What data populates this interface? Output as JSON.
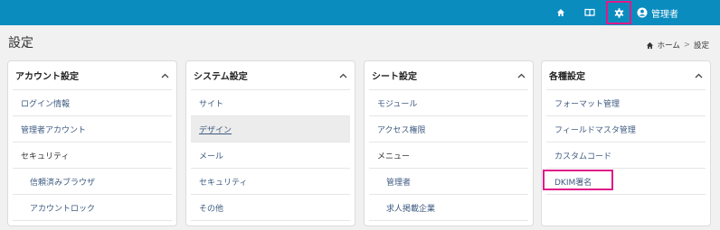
{
  "header": {
    "user_name": "管理者"
  },
  "page": {
    "title": "設定",
    "breadcrumb": {
      "home": "ホーム",
      "sep": ">",
      "current": "設定"
    }
  },
  "cards": [
    {
      "title": "アカウント設定",
      "items": [
        {
          "label": "ログイン情報"
        },
        {
          "label": "管理者アカウント"
        },
        {
          "label": "セキュリティ"
        },
        {
          "label": "信頼済みブラウザ"
        },
        {
          "label": "アカウントロック"
        }
      ]
    },
    {
      "title": "システム設定",
      "items": [
        {
          "label": "サイト"
        },
        {
          "label": "デザイン"
        },
        {
          "label": "メール"
        },
        {
          "label": "セキュリティ"
        },
        {
          "label": "その他"
        }
      ]
    },
    {
      "title": "シート設定",
      "items": [
        {
          "label": "モジュール"
        },
        {
          "label": "アクセス権限"
        },
        {
          "label": "メニュー"
        },
        {
          "label": "管理者"
        },
        {
          "label": "求人掲載企業"
        }
      ]
    },
    {
      "title": "各種設定",
      "items": [
        {
          "label": "フォーマット管理"
        },
        {
          "label": "フィールドマスタ管理"
        },
        {
          "label": "カスタムコード"
        },
        {
          "label": "DKIM署名"
        }
      ]
    }
  ],
  "colors": {
    "header_bg": "#0a8cbf",
    "highlight": "#e0198a",
    "link": "#3d5a80"
  }
}
